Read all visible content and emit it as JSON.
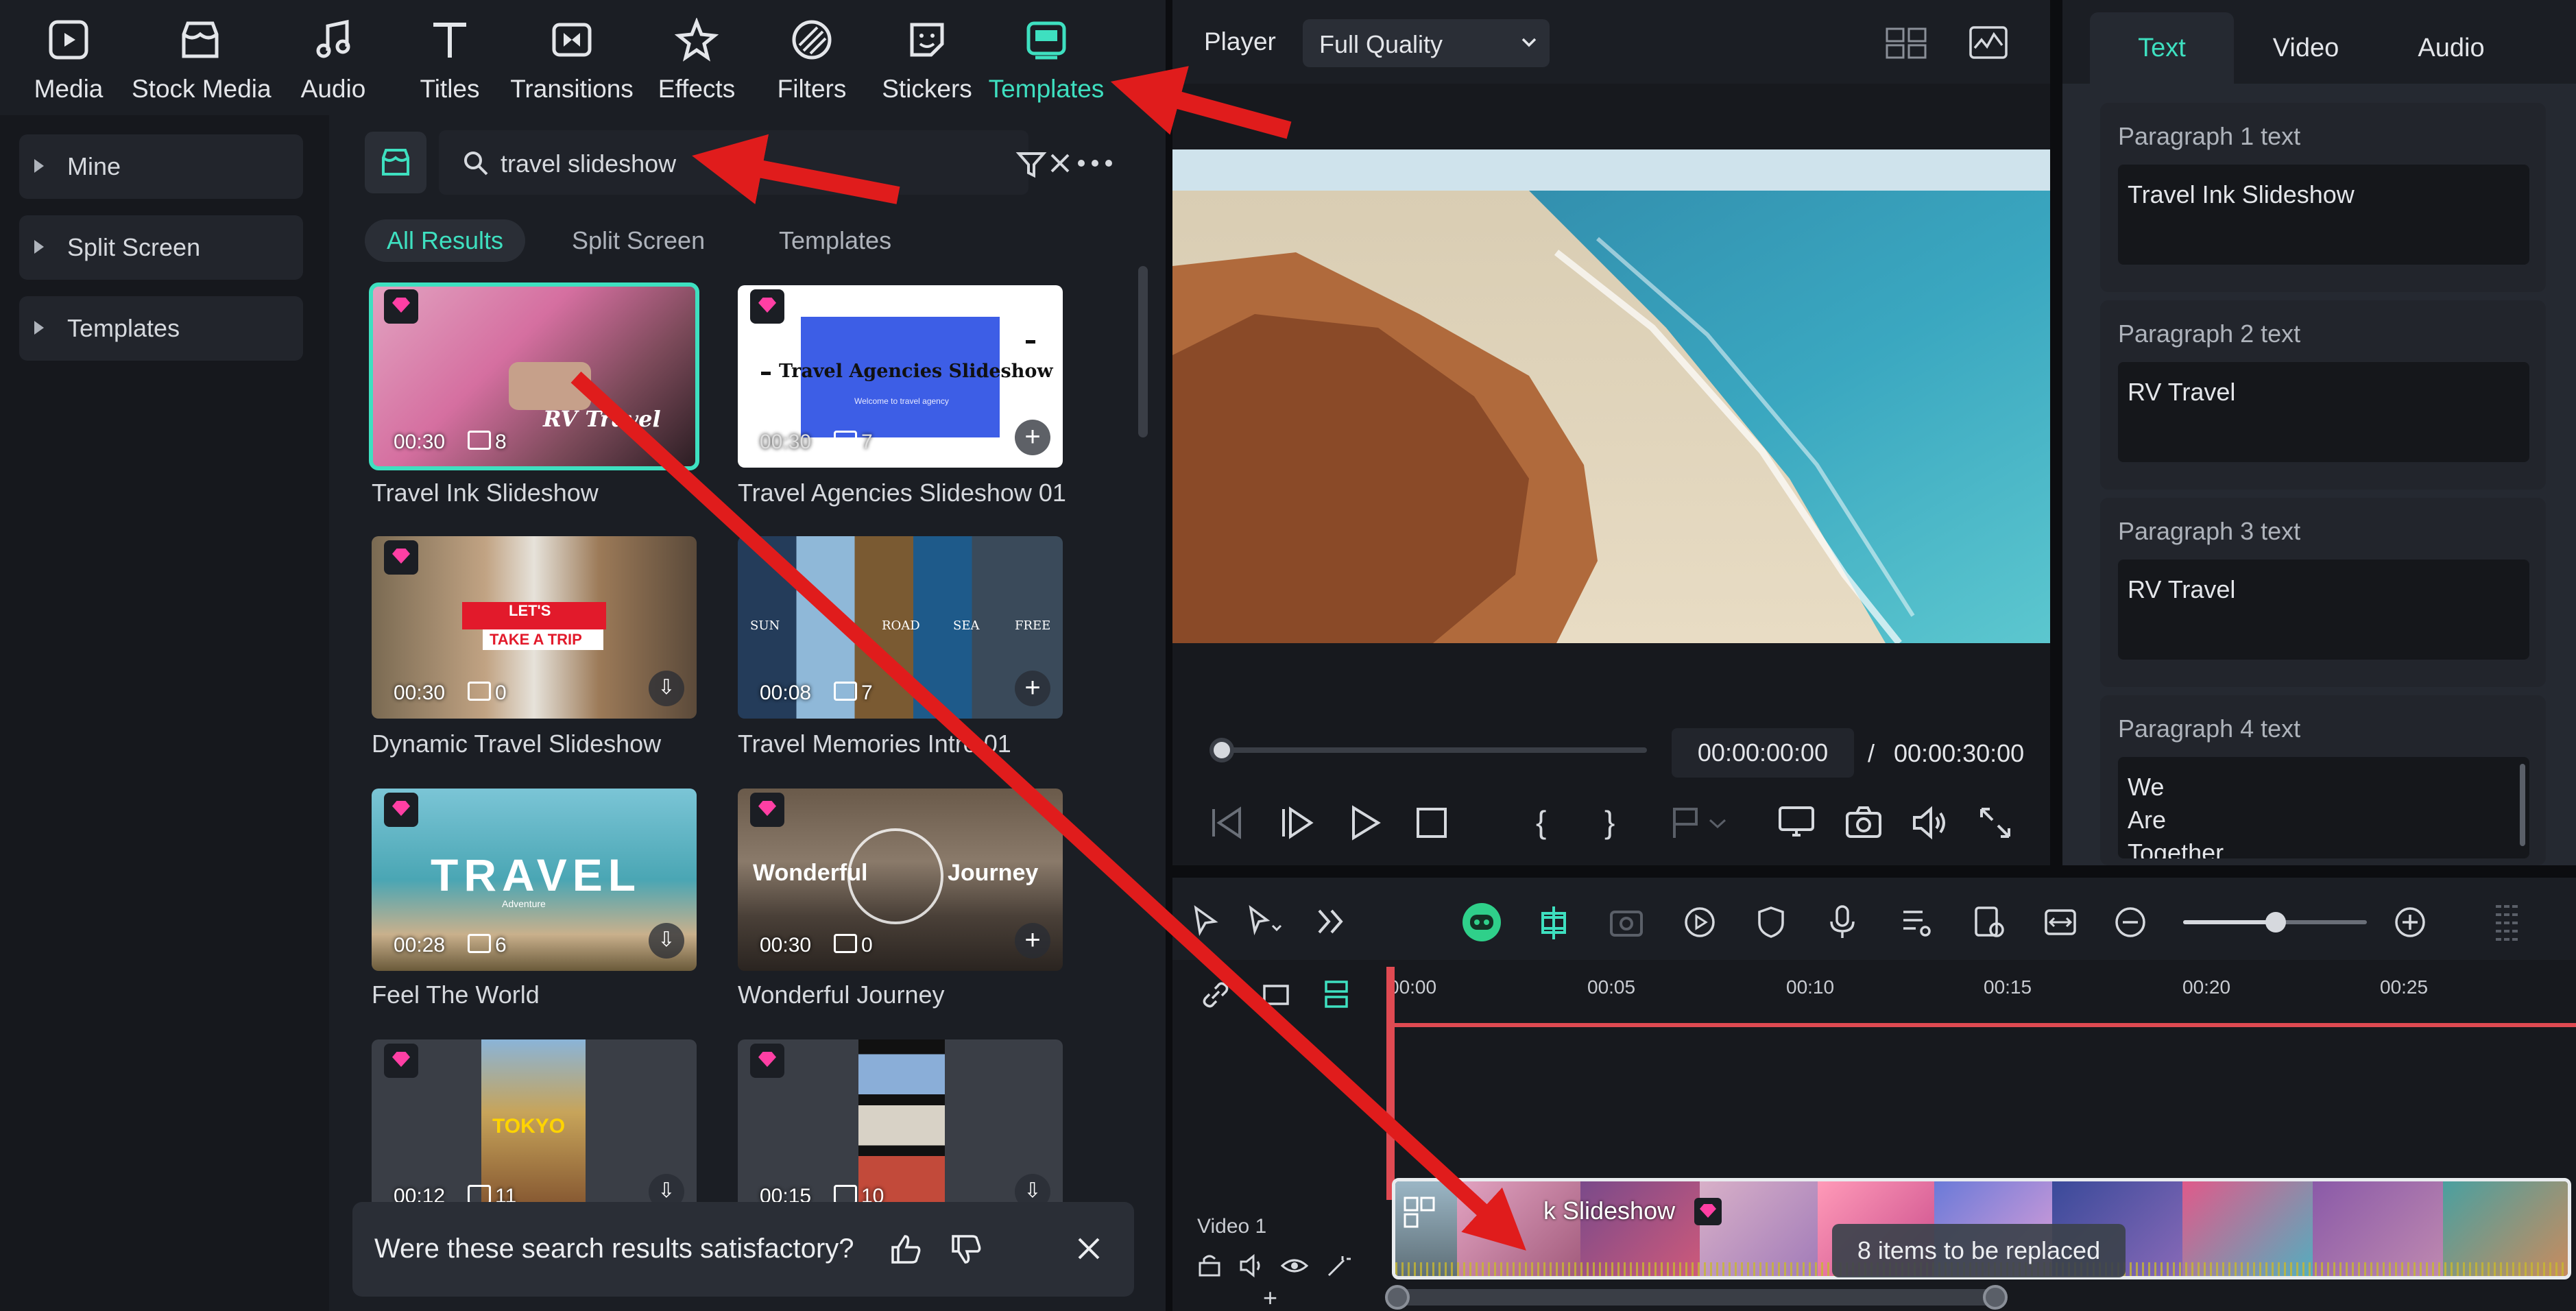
{
  "toolbar": {
    "items": [
      {
        "label": "Media",
        "icon": "media-icon"
      },
      {
        "label": "Stock Media",
        "icon": "stock-media-icon"
      },
      {
        "label": "Audio",
        "icon": "audio-note-icon"
      },
      {
        "label": "Titles",
        "icon": "titles-T-icon"
      },
      {
        "label": "Transitions",
        "icon": "transitions-icon"
      },
      {
        "label": "Effects",
        "icon": "effects-star-icon"
      },
      {
        "label": "Filters",
        "icon": "filters-icon"
      },
      {
        "label": "Stickers",
        "icon": "stickers-icon"
      },
      {
        "label": "Templates",
        "icon": "templates-icon",
        "active": true
      }
    ],
    "accent": "#3ee0c0"
  },
  "sidebar": {
    "items": [
      {
        "label": "Mine"
      },
      {
        "label": "Split Screen"
      },
      {
        "label": "Templates"
      }
    ]
  },
  "browser": {
    "search_value": "travel slideshow",
    "filters": [
      {
        "label": "All Results",
        "active": true
      },
      {
        "label": "Split Screen"
      },
      {
        "label": "Templates"
      }
    ],
    "cards": [
      {
        "name": "Travel Ink Slideshow",
        "duration": "00:30",
        "count": "8",
        "overlay": "RV Travel"
      },
      {
        "name": "Travel Agencies Slideshow 01",
        "duration": "00:30",
        "count": "7",
        "overlay": "Travel Agencies Slideshow",
        "overlay_sub": "Welcome to travel agency"
      },
      {
        "name": "Dynamic Travel Slideshow",
        "duration": "00:30",
        "count": "0",
        "overlay": "LET'S",
        "overlay_sub": "TAKE A TRIP"
      },
      {
        "name": "Travel Memories Intro 01",
        "duration": "00:08",
        "count": "7",
        "overlay_words": [
          "SUN",
          "ROAD",
          "SEA",
          "FREE"
        ]
      },
      {
        "name": "Feel The World",
        "duration": "00:28",
        "count": "6",
        "overlay": "TRAVEL",
        "overlay_sub": "Adventure"
      },
      {
        "name": "Wonderful Journey",
        "duration": "00:30",
        "count": "0",
        "overlay": "Wonderful",
        "overlay2": "Journey"
      },
      {
        "name": "",
        "duration": "00:12",
        "count": "11",
        "overlay": "TOKYO"
      },
      {
        "name": "",
        "duration": "00:15",
        "count": "10",
        "overlay": ""
      }
    ],
    "feedback": {
      "question": "Were these search results satisfactory?"
    }
  },
  "player": {
    "label": "Player",
    "quality": "Full Quality",
    "current_time": "00:00:00:00",
    "separator": "/",
    "total_time": "00:00:30:00"
  },
  "properties": {
    "tabs": [
      {
        "label": "Text",
        "active": true
      },
      {
        "label": "Video"
      },
      {
        "label": "Audio"
      }
    ],
    "paragraphs": [
      {
        "heading": "Paragraph 1 text",
        "value": "Travel Ink Slideshow"
      },
      {
        "heading": "Paragraph 2 text",
        "value": "RV Travel"
      },
      {
        "heading": "Paragraph 3 text",
        "value": "RV Travel"
      },
      {
        "heading": "Paragraph 4 text",
        "value": "  We\n  Are\n  Together"
      }
    ]
  },
  "timeline": {
    "ticks": [
      "00:00",
      "00:05",
      "00:10",
      "00:15",
      "00:20",
      "00:25"
    ],
    "track_label": "Video 1",
    "clip_title": "Travel Ink Slideshow",
    "clip_title_visible": "k Slideshow",
    "replace_text": "8 items to be replaced"
  },
  "annotation_color": "#e01c1c"
}
